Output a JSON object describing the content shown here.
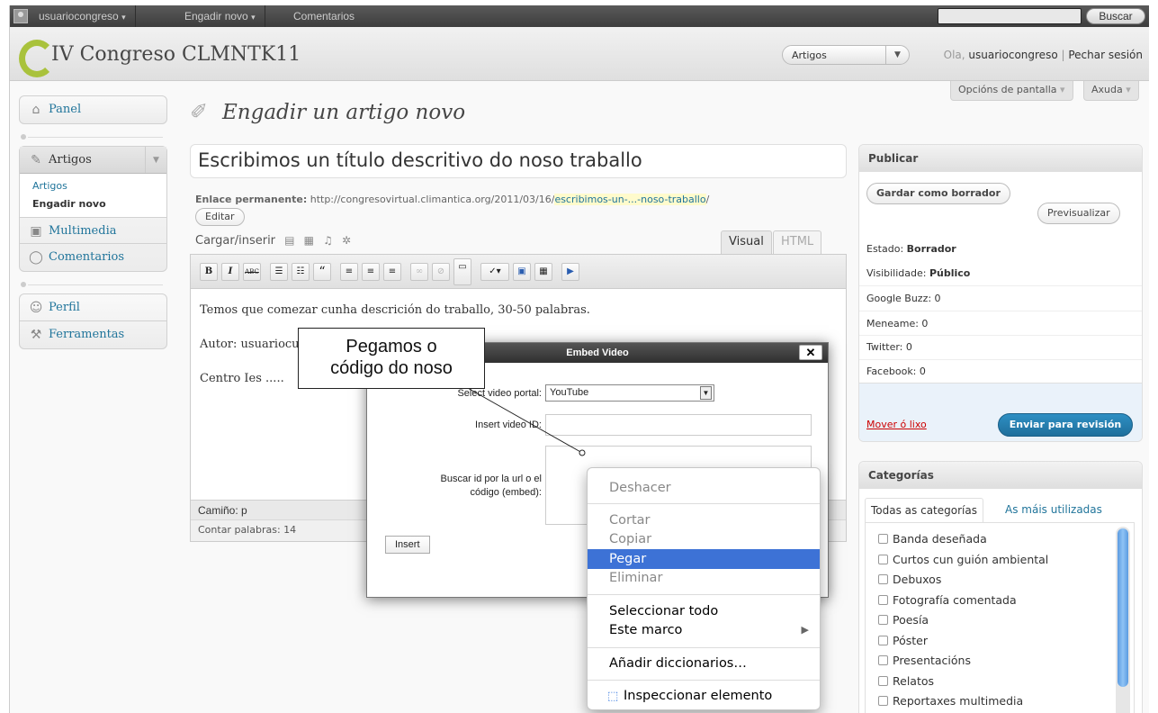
{
  "adminbar": {
    "user": "usuariocongreso",
    "new_item": "Engadir novo",
    "comments": "Comentarios",
    "search_button": "Buscar",
    "dropdown_glyph": "▾"
  },
  "header": {
    "site_title": "IV Congreso CLMNTK11",
    "favorites_select": "Artigos",
    "greeting_prefix": "Ola, ",
    "greeting_user": "usuariocongreso",
    "separator": " | ",
    "logout": "Pechar sesión"
  },
  "screen_options": {
    "options_label": "Opcións de pantalla",
    "help_label": "Axuda",
    "arrow": "▾"
  },
  "menu": {
    "panel": "Panel",
    "posts": "Artigos",
    "posts_sub": [
      "Artigos",
      "Engadir novo"
    ],
    "media": "Multimedia",
    "comments": "Comentarios",
    "profile": "Perfil",
    "tools": "Ferramentas",
    "collapse_arrow": "▼"
  },
  "page": {
    "title": "Engadir un artigo novo",
    "post_title": "Escribimos un título descritivo do noso traballo",
    "permalink_label": "Enlace permanente:",
    "permalink_base": " http://congresovirtual.climantica.org/2011/03/16/",
    "permalink_slug": "escribimos-un-...-noso-traballo",
    "permalink_end": "/",
    "edit_button": "Editar",
    "upload_insert": "Cargar/inserir",
    "tab_visual": "Visual",
    "tab_html": "HTML"
  },
  "editor": {
    "content": [
      "Temos que comezar cunha descrición do traballo, 30-50 palabras.",
      "Autor: usuariocur",
      "Centro Ies ....."
    ],
    "path_label": "Camiño: p",
    "word_count": "Contar palabras: 14",
    "toolbar": {
      "bold": "B",
      "italic": "I",
      "strike": "ABC",
      "quote": "“"
    }
  },
  "publish": {
    "title": "Publicar",
    "save_draft": "Gardar como borrador",
    "preview": "Previsualizar",
    "status_label": "Estado: ",
    "status_value": "Borrador",
    "visibility_label": "Visibilidade: ",
    "visibility_value": "Público",
    "google_buzz": "Google Buzz: 0",
    "meneame": "Meneame: 0",
    "twitter": "Twitter: 0",
    "facebook": "Facebook: 0",
    "trash": "Mover ó lixo",
    "submit": "Enviar para revisión"
  },
  "categories": {
    "title": "Categorías",
    "tab_all": "Todas as categorías",
    "tab_popular": "As máis utilizadas",
    "items": [
      "Banda deseñada",
      "Curtos cun guión ambiental",
      "Debuxos",
      "Fotografía comentada",
      "Poesía",
      "Póster",
      "Presentacións",
      "Relatos",
      "Reportaxes multimedia"
    ]
  },
  "modal": {
    "title": "Embed Video",
    "close": "✕",
    "portal_label": "Select video portal:",
    "portal_value": "YouTube",
    "video_id_label": "Insert video ID:",
    "embed_label_1": "Buscar id por la url o el",
    "embed_label_2": "código (embed):",
    "insert_button": "Insert"
  },
  "callout": {
    "line1": "Pegamos o",
    "line2": "código do noso"
  },
  "context_menu": {
    "undo": "Deshacer",
    "cut": "Cortar",
    "copy": "Copiar",
    "paste": "Pegar",
    "delete": "Eliminar",
    "select_all": "Seleccionar todo",
    "this_frame": "Este marco",
    "add_dictionaries": "Añadir diccionarios…",
    "inspect": "Inspeccionar elemento",
    "submenu_arrow": "▶"
  },
  "colors": {
    "link": "#21759b",
    "submit": "#2e8fc3",
    "highlight": "#3d72d6",
    "trash": "#cc0000",
    "logo": "#a9c23c"
  },
  "icons": [
    "avatar-icon",
    "pin-icon",
    "home-icon",
    "media-icon",
    "comment-icon",
    "profile-icon",
    "tools-icon",
    "close-icon",
    "inspect-icon"
  ]
}
